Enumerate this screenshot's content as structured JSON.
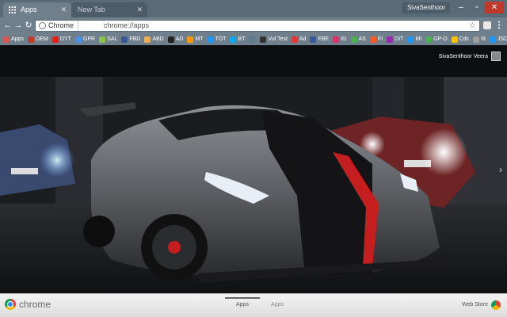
{
  "tabs": [
    {
      "title": "Apps",
      "active": true
    },
    {
      "title": "New Tab",
      "active": false
    }
  ],
  "profile": {
    "name": "SivaSenthoor"
  },
  "toolbar": {
    "chip": "Chrome",
    "url": "chrome://apps"
  },
  "bookmarks": [
    {
      "label": "Apps",
      "color": "#d9534f"
    },
    {
      "label": "OEM",
      "color": "#c0392b"
    },
    {
      "label": "DYT",
      "color": "#e62117"
    },
    {
      "label": "GPR",
      "color": "#4a90e2"
    },
    {
      "label": "SAL",
      "color": "#8bc34a"
    },
    {
      "label": "FBD",
      "color": "#3b5998"
    },
    {
      "label": "ABD",
      "color": "#f0ad4e"
    },
    {
      "label": "AD",
      "color": "#222222"
    },
    {
      "label": "MT",
      "color": "#ff9800"
    },
    {
      "label": "TOT",
      "color": "#2196f3"
    },
    {
      "label": "BT",
      "color": "#03a9f4"
    },
    {
      "label": "",
      "color": "#607d8b"
    },
    {
      "label": "Vul Test",
      "color": "#333333"
    },
    {
      "label": "Ad",
      "color": "#e53935"
    },
    {
      "label": "FBE",
      "color": "#3b5998"
    },
    {
      "label": "IG",
      "color": "#e1306c"
    },
    {
      "label": "AS",
      "color": "#4caf50"
    },
    {
      "label": "FI",
      "color": "#ff5722"
    },
    {
      "label": "DIT",
      "color": "#9c27b0"
    },
    {
      "label": "MI",
      "color": "#2196f3"
    },
    {
      "label": "GP-D",
      "color": "#4caf50"
    },
    {
      "label": "Cdc",
      "color": "#ffc107"
    },
    {
      "label": "I9",
      "color": "#9e9e9e"
    },
    {
      "label": "JSD",
      "color": "#2196f3"
    }
  ],
  "wallpaper": {
    "user_name": "SivaSenthoor Veera"
  },
  "appbar": {
    "brand": "chrome",
    "pages": [
      {
        "label": "Apps",
        "active": true
      },
      {
        "label": "Apps",
        "active": false
      }
    ],
    "webstore": "Web Store"
  }
}
